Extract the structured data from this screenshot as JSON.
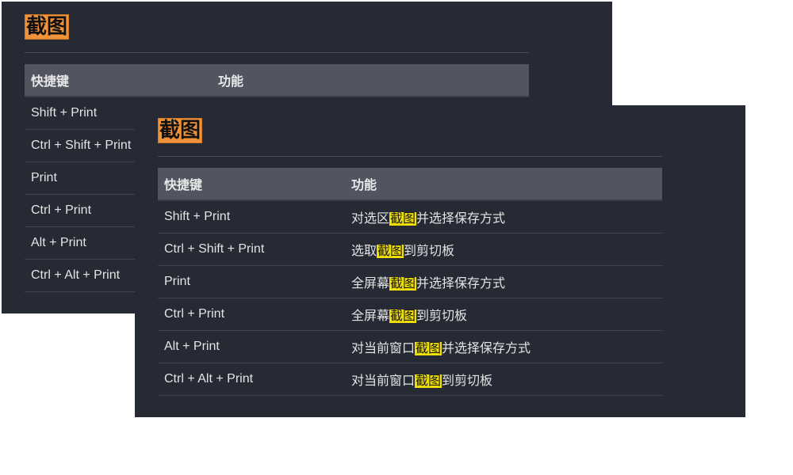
{
  "back_panel": {
    "title": "截图",
    "header": {
      "key": "快捷键",
      "function": "功能"
    },
    "rows": [
      {
        "key": "Shift + Print"
      },
      {
        "key": "Ctrl + Shift + Print"
      },
      {
        "key": "Print"
      },
      {
        "key": "Ctrl + Print"
      },
      {
        "key": "Alt + Print"
      },
      {
        "key": "Ctrl + Alt + Print"
      }
    ]
  },
  "front_panel": {
    "title": "截图",
    "header": {
      "key": "快捷键",
      "function": "功能"
    },
    "highlight_word": "截图",
    "rows": [
      {
        "key": "Shift + Print",
        "function_pre": "对选区",
        "function_post": "并选择保存方式"
      },
      {
        "key": "Ctrl + Shift + Print",
        "function_pre": "选取",
        "function_post": "到剪切板"
      },
      {
        "key": "Print",
        "function_pre": "全屏幕",
        "function_post": "并选择保存方式"
      },
      {
        "key": "Ctrl + Print",
        "function_pre": "全屏幕",
        "function_post": "到剪切板"
      },
      {
        "key": "Alt + Print",
        "function_pre": "对当前窗口",
        "function_post": "并选择保存方式"
      },
      {
        "key": "Ctrl + Alt + Print",
        "function_pre": "对当前窗口",
        "function_post": "到剪切板"
      }
    ]
  },
  "colors": {
    "panel_bg": "#262a34",
    "header_bg": "#515560",
    "title_badge": "#f0923a",
    "highlight": "#f2e100"
  }
}
